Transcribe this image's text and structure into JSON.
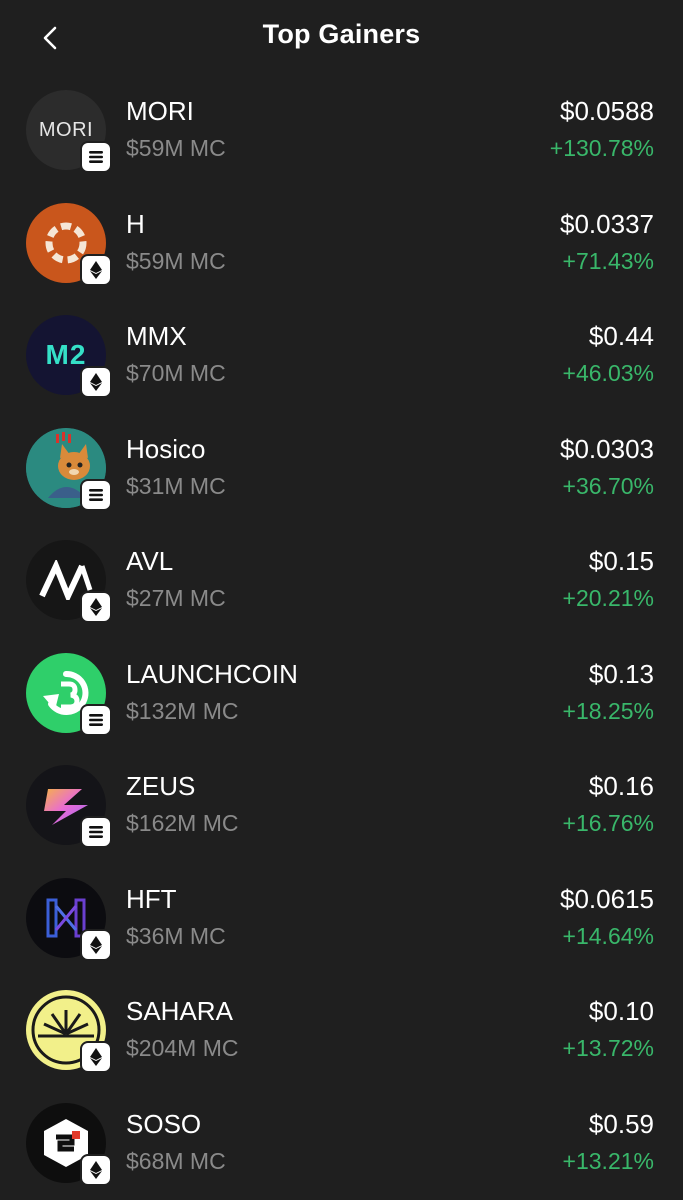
{
  "header": {
    "title": "Top Gainers"
  },
  "colors": {
    "gain": "#39b76a",
    "background": "#1f1f1f",
    "muted": "#8a8a8a"
  },
  "tokens": [
    {
      "symbol": "MORI",
      "market_cap": "$59M MC",
      "price": "$0.0588",
      "change": "+130.78%",
      "chain": "solana-icon",
      "logo_text": "MORI"
    },
    {
      "symbol": "H",
      "market_cap": "$59M MC",
      "price": "$0.0337",
      "change": "+71.43%",
      "chain": "ethereum-icon"
    },
    {
      "symbol": "MMX",
      "market_cap": "$70M MC",
      "price": "$0.44",
      "change": "+46.03%",
      "chain": "ethereum-icon",
      "logo_text": "M2"
    },
    {
      "symbol": "Hosico",
      "market_cap": "$31M MC",
      "price": "$0.0303",
      "change": "+36.70%",
      "chain": "solana-icon"
    },
    {
      "symbol": "AVL",
      "market_cap": "$27M MC",
      "price": "$0.15",
      "change": "+20.21%",
      "chain": "ethereum-icon"
    },
    {
      "symbol": "LAUNCHCOIN",
      "market_cap": "$132M MC",
      "price": "$0.13",
      "change": "+18.25%",
      "chain": "solana-icon"
    },
    {
      "symbol": "ZEUS",
      "market_cap": "$162M MC",
      "price": "$0.16",
      "change": "+16.76%",
      "chain": "solana-icon"
    },
    {
      "symbol": "HFT",
      "market_cap": "$36M MC",
      "price": "$0.0615",
      "change": "+14.64%",
      "chain": "ethereum-icon"
    },
    {
      "symbol": "SAHARA",
      "market_cap": "$204M MC",
      "price": "$0.10",
      "change": "+13.72%",
      "chain": "ethereum-icon"
    },
    {
      "symbol": "SOSO",
      "market_cap": "$68M MC",
      "price": "$0.59",
      "change": "+13.21%",
      "chain": "ethereum-icon"
    }
  ]
}
